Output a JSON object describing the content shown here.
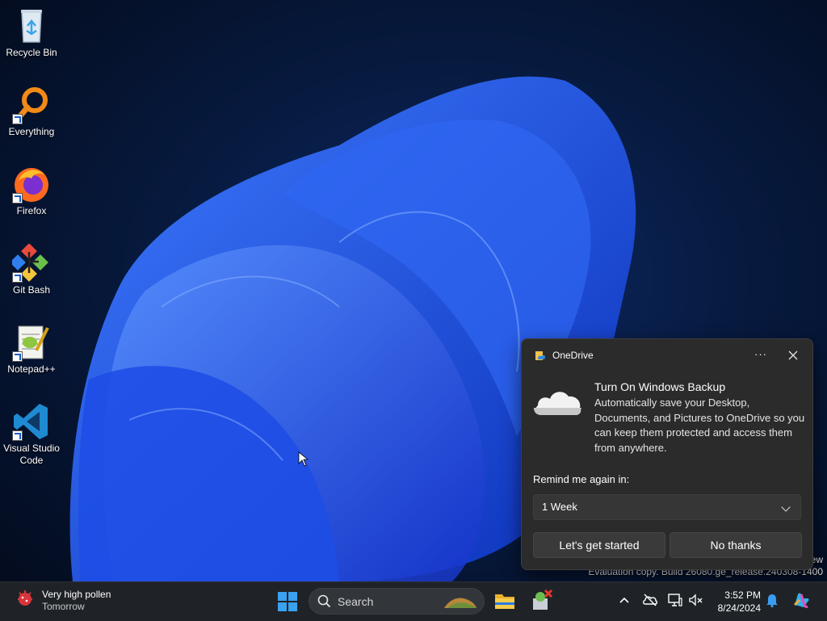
{
  "desktop": {
    "icons": [
      {
        "label": "Recycle Bin",
        "icon": "recycle-bin-icon"
      },
      {
        "label": "Everything",
        "icon": "everything-search-icon"
      },
      {
        "label": "Firefox",
        "icon": "firefox-icon"
      },
      {
        "label": "Git Bash",
        "icon": "git-bash-icon"
      },
      {
        "label": "Notepad++",
        "icon": "notepad-plus-plus-icon"
      },
      {
        "label": "Visual Studio Code",
        "icon": "vscode-icon"
      }
    ],
    "watermark": {
      "line1_partial": "ew",
      "line2": "Evaluation copy. Build 26080.ge_release.240308-1400"
    }
  },
  "notification": {
    "app_name": "OneDrive",
    "more_label": "···",
    "title": "Turn On Windows Backup",
    "body": "Automatically save your Desktop, Documents, and Pictures to OneDrive so you can keep them protected and access them from anywhere.",
    "remind_label": "Remind me again in:",
    "remind_value": "1 Week",
    "primary_button": "Let's get started",
    "secondary_button": "No thanks"
  },
  "taskbar": {
    "weather": {
      "title": "Very high pollen",
      "subtitle": "Tomorrow"
    },
    "search_placeholder": "Search",
    "clock": {
      "time": "3:52 PM",
      "date": "8/24/2024"
    }
  },
  "colors": {
    "wallpaper_accent": "#1f4fe0",
    "toast_bg": "#2b2b2b",
    "taskbar_bg": "#1f2328"
  }
}
